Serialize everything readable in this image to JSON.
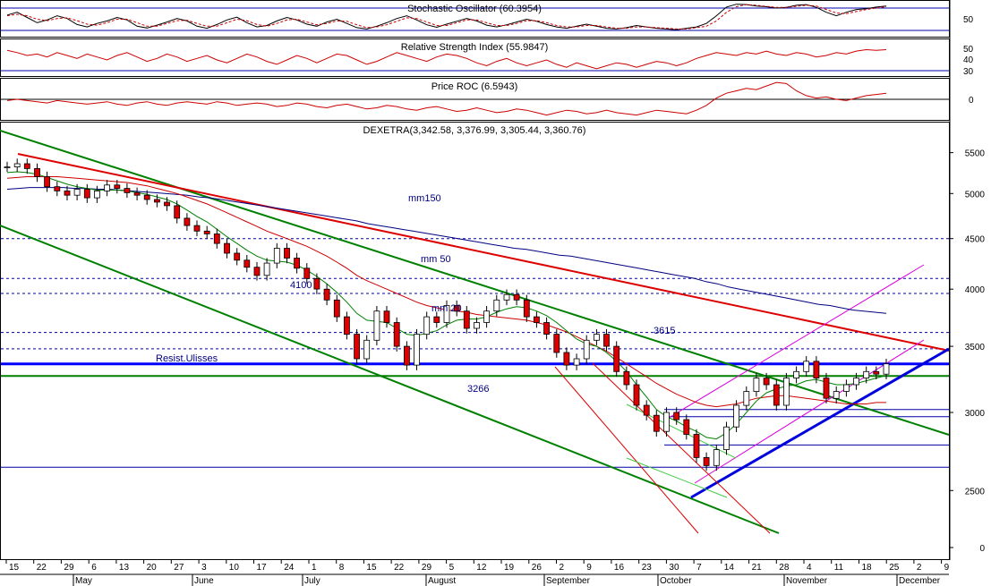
{
  "chart_data": [
    {
      "type": "line",
      "title": "Stochastic Oscillator (60.3954)",
      "ylim": [
        0,
        100
      ],
      "ticks": [
        50
      ],
      "ref_levels": [
        80,
        20
      ],
      "series": [
        {
          "name": "%K",
          "values": [
            62,
            70,
            55,
            40,
            48,
            60,
            52,
            35,
            28,
            38,
            45,
            55,
            48,
            30,
            25,
            33,
            42,
            52,
            45,
            30,
            24,
            35,
            48,
            56,
            40,
            28,
            32,
            45,
            55,
            48,
            36,
            30,
            42,
            50,
            38,
            26,
            22,
            30,
            40,
            52,
            60,
            48,
            34,
            27,
            36,
            44,
            52,
            45,
            33,
            28,
            34,
            42,
            50,
            44,
            35,
            28,
            24,
            30,
            36,
            30,
            24,
            22,
            26,
            32,
            28,
            24,
            22,
            20,
            24,
            28,
            38,
            60,
            85,
            93,
            92,
            88,
            86,
            82,
            84,
            90,
            92,
            84,
            70,
            60,
            70,
            78,
            80,
            85,
            88
          ]
        },
        {
          "values": [
            60,
            64,
            60,
            50,
            46,
            52,
            54,
            46,
            36,
            33,
            40,
            50,
            50,
            40,
            30,
            30,
            38,
            46,
            47,
            38,
            30,
            30,
            40,
            50,
            46,
            35,
            30,
            38,
            48,
            50,
            42,
            34,
            38,
            45,
            44,
            34,
            26,
            28,
            34,
            44,
            54,
            52,
            42,
            32,
            32,
            40,
            48,
            48,
            40,
            32,
            32,
            38,
            46,
            46,
            40,
            32,
            28,
            28,
            32,
            32,
            28,
            24,
            24,
            28,
            28,
            26,
            24,
            22,
            22,
            26,
            30,
            45,
            70,
            86,
            92,
            90,
            87,
            84,
            84,
            87,
            90,
            88,
            78,
            68,
            66,
            72,
            78,
            82,
            86
          ]
        }
      ]
    },
    {
      "type": "line",
      "title": "Relative Strength Index (55.9847)",
      "ylim": [
        20,
        70
      ],
      "ticks": [
        50,
        40,
        30
      ],
      "ref_levels": [
        30
      ],
      "series": [
        {
          "values": [
            55,
            52,
            48,
            50,
            46,
            52,
            48,
            44,
            50,
            46,
            42,
            48,
            52,
            46,
            40,
            44,
            50,
            46,
            40,
            44,
            48,
            42,
            38,
            44,
            50,
            46,
            40,
            36,
            42,
            48,
            44,
            38,
            44,
            50,
            48,
            42,
            36,
            40,
            46,
            52,
            48,
            44,
            40,
            46,
            50,
            48,
            44,
            38,
            34,
            40,
            44,
            38,
            34,
            38,
            42,
            36,
            32,
            38,
            34,
            30,
            34,
            38,
            36,
            32,
            36,
            40,
            38,
            34,
            38,
            44,
            48,
            52,
            50,
            48,
            52,
            50,
            54,
            50,
            48,
            52,
            50,
            46,
            48,
            52,
            50,
            54,
            56,
            55,
            56
          ]
        }
      ]
    },
    {
      "type": "line",
      "title": "Price ROC (6.5943)",
      "ylim": [
        -16,
        18
      ],
      "ticks": [
        0
      ],
      "ref_levels": [
        0
      ],
      "series": [
        {
          "values": [
            0,
            1,
            0,
            -1,
            -2,
            0,
            -1,
            -2,
            -3,
            -2,
            -1,
            -3,
            -4,
            -2,
            -1,
            -3,
            -4,
            -2,
            -1,
            -2,
            -3,
            -1,
            -2,
            -4,
            -3,
            -2,
            -3,
            -5,
            -4,
            -2,
            -3,
            -5,
            -6,
            -4,
            -3,
            -5,
            -7,
            -6,
            -4,
            -5,
            -7,
            -8,
            -6,
            -5,
            -7,
            -9,
            -8,
            -6,
            -8,
            -10,
            -9,
            -7,
            -8,
            -10,
            -12,
            -10,
            -8,
            -9,
            -11,
            -10,
            -8,
            -10,
            -11,
            -12,
            -10,
            -8,
            -9,
            -10,
            -11,
            -8,
            -4,
            2,
            6,
            8,
            10,
            9,
            12,
            15,
            14,
            8,
            4,
            2,
            3,
            1,
            0,
            2,
            4,
            5,
            6
          ]
        }
      ]
    },
    {
      "type": "candlestick",
      "title": "DEXETRA(3,342.58, 3,376.99, 3,305.44, 3,360.76)",
      "yscale": "log",
      "ylim": [
        2130,
        5900
      ],
      "y_ticks": [
        5500,
        5000,
        4500,
        4000,
        3500,
        3000,
        2500,
        0
      ],
      "x_tick_labels": [
        "15",
        "22",
        "29",
        "6",
        "13",
        "20",
        "27",
        "3",
        "10",
        "17",
        "24",
        "1",
        "8",
        "15",
        "22",
        "29",
        "5",
        "12",
        "19",
        "26",
        "2",
        "9",
        "16",
        "23",
        "30",
        "7",
        "14",
        "21",
        "28",
        "4",
        "11",
        "18",
        "25",
        "2",
        "9"
      ],
      "month_labels": [
        "May",
        "June",
        "July",
        "August",
        "September",
        "October",
        "November",
        "December"
      ],
      "annotations": [
        "mm150",
        "mm 50",
        "mm 20",
        "4100",
        "Resist.Ulisses",
        "3266",
        "3615"
      ],
      "series": [
        {
          "name": "close",
          "values": [
            5320,
            5360,
            5300,
            5200,
            5080,
            5030,
            4980,
            5050,
            4950,
            5030,
            5100,
            5060,
            5010,
            4980,
            4930,
            4900,
            4860,
            4720,
            4640,
            4580,
            4550,
            4450,
            4350,
            4280,
            4210,
            4130,
            4250,
            4400,
            4300,
            4200,
            4100,
            4000,
            3900,
            3750,
            3600,
            3400,
            3550,
            3800,
            3700,
            3500,
            3350,
            3600,
            3750,
            3700,
            3850,
            3800,
            3650,
            3700,
            3800,
            3900,
            3950,
            3900,
            3750,
            3700,
            3600,
            3450,
            3350,
            3400,
            3550,
            3600,
            3500,
            3300,
            3200,
            3050,
            2980,
            2870,
            3000,
            2950,
            2850,
            2700,
            2650,
            2750,
            2900,
            3050,
            3150,
            3250,
            3200,
            3050,
            3250,
            3300,
            3380,
            3250,
            3100,
            3150,
            3200,
            3250,
            3300,
            3280,
            3360
          ]
        },
        {
          "name": "mm 20",
          "values": [
            5250,
            5260,
            5250,
            5230,
            5190,
            5150,
            5110,
            5080,
            5060,
            5040,
            5040,
            5040,
            5030,
            5010,
            4990,
            4960,
            4930,
            4880,
            4810,
            4740,
            4680,
            4600,
            4520,
            4450,
            4380,
            4320,
            4280,
            4270,
            4260,
            4230,
            4180,
            4120,
            4050,
            3970,
            3880,
            3780,
            3720,
            3710,
            3700,
            3650,
            3600,
            3590,
            3610,
            3630,
            3680,
            3720,
            3730,
            3730,
            3750,
            3790,
            3820,
            3840,
            3830,
            3800,
            3760,
            3700,
            3630,
            3560,
            3520,
            3500,
            3450,
            3380,
            3300,
            3200,
            3110,
            3020,
            2970,
            2940,
            2900,
            2870,
            2830,
            2820,
            2860,
            2920,
            3000,
            3080,
            3140,
            3170,
            3190,
            3200,
            3230,
            3240,
            3220,
            3200,
            3200,
            3210,
            3230,
            3250,
            3270
          ]
        },
        {
          "name": "mm 50",
          "values": [
            5180,
            5190,
            5200,
            5200,
            5200,
            5200,
            5190,
            5180,
            5170,
            5160,
            5150,
            5140,
            5130,
            5110,
            5090,
            5060,
            5030,
            5000,
            4960,
            4920,
            4880,
            4830,
            4780,
            4730,
            4680,
            4630,
            4580,
            4540,
            4500,
            4460,
            4420,
            4370,
            4320,
            4260,
            4200,
            4130,
            4080,
            4040,
            4000,
            3960,
            3920,
            3880,
            3850,
            3830,
            3810,
            3800,
            3790,
            3770,
            3760,
            3750,
            3740,
            3730,
            3720,
            3700,
            3680,
            3650,
            3620,
            3580,
            3540,
            3500,
            3460,
            3410,
            3360,
            3310,
            3260,
            3210,
            3170,
            3130,
            3100,
            3070,
            3050,
            3040,
            3050,
            3060,
            3080,
            3100,
            3110,
            3120,
            3120,
            3110,
            3100,
            3090,
            3080,
            3070,
            3060,
            3060,
            3060,
            3070,
            3070
          ]
        },
        {
          "name": "mm150",
          "values": [
            5050,
            5060,
            5070,
            5070,
            5070,
            5070,
            5060,
            5060,
            5050,
            5050,
            5040,
            5030,
            5020,
            5010,
            5000,
            4990,
            4980,
            4960,
            4950,
            4930,
            4910,
            4890,
            4870,
            4850,
            4830,
            4810,
            4790,
            4770,
            4750,
            4730,
            4710,
            4690,
            4660,
            4640,
            4620,
            4600,
            4580,
            4560,
            4540,
            4520,
            4500,
            4480,
            4460,
            4440,
            4420,
            4400,
            4390,
            4370,
            4350,
            4330,
            4320,
            4300,
            4280,
            4260,
            4240,
            4220,
            4200,
            4180,
            4160,
            4140,
            4120,
            4100,
            4070,
            4050,
            4020,
            4000,
            3980,
            3960,
            3940,
            3920,
            3900,
            3880,
            3860,
            3850,
            3830,
            3810,
            3800,
            3790,
            3780
          ]
        }
      ],
      "horizontal_levels": [
        4500,
        4100,
        3960,
        3615,
        3480,
        3360,
        3266,
        3020,
        2970,
        2780,
        2640
      ],
      "grid": false
    }
  ]
}
